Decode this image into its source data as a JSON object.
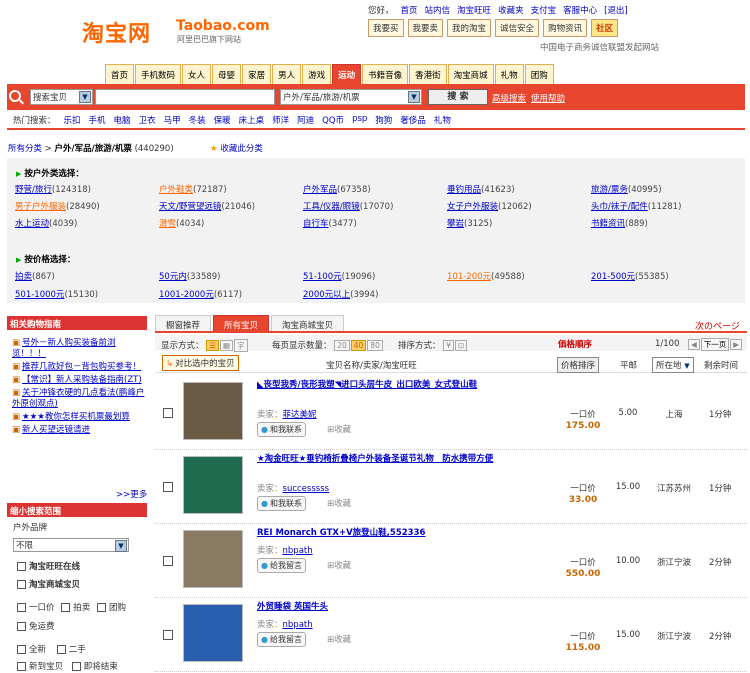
{
  "header": {
    "logo_cn": "淘宝网",
    "logo_en": "Taobao.com",
    "logo_sub": "阿里巴巴旗下网站",
    "greeting": "您好，",
    "top_links": [
      "首页",
      "站内信",
      "淘宝旺旺",
      "收藏夹",
      "支付宝",
      "客服中心",
      "[退出]"
    ],
    "top_buttons": [
      "我要买",
      "我要卖",
      "我的淘宝",
      "诚信安全",
      "购物资讯",
      "社区"
    ],
    "slogan": "中国电子商务诚信联盟发起网站"
  },
  "nav": {
    "tabs": [
      "首页",
      "手机数码",
      "女人",
      "母婴",
      "家居",
      "男人",
      "游戏",
      "运动",
      "书籍音像",
      "香港街",
      "淘宝商城",
      "礼物",
      "团购"
    ],
    "active_index": 7
  },
  "search": {
    "type_select": "搜索宝贝",
    "query": "",
    "category_select": "户外/军品/旅游/机票",
    "button": "搜 索",
    "advanced": "高级搜索",
    "help": "使用帮助"
  },
  "hot": {
    "label": "热门搜索：",
    "items": [
      "乐扣",
      "手机",
      "电脑",
      "卫衣",
      "马甲",
      "冬装",
      "保暖",
      "床上桌",
      "师洋",
      "阿迪",
      "QQ币",
      "psp",
      "狗狗",
      "奢侈品",
      "礼物"
    ]
  },
  "breadcrumb": {
    "root": "所有分类",
    "sep": ">",
    "current": "户外/军品/旅游/机票",
    "count": "(440290)",
    "favorite": "收藏此分类"
  },
  "outdoor_section": {
    "title": "按户外类选择：",
    "items": [
      {
        "name": "野营/旅行",
        "count": "(124318)",
        "style": "n"
      },
      {
        "name": "户外鞋类",
        "count": "(72187)",
        "style": "or"
      },
      {
        "name": "户外军品",
        "count": "(67358)",
        "style": "n"
      },
      {
        "name": "垂钓用品",
        "count": "(41623)",
        "style": "n"
      },
      {
        "name": "旅游/票务",
        "count": "(40995)",
        "style": "n"
      },
      {
        "name": "男子户外服装",
        "count": "(28490)",
        "style": "or"
      },
      {
        "name": "天文/野营望远镜",
        "count": "(21046)",
        "style": "n"
      },
      {
        "name": "工具/仪器/眼镜",
        "count": "(17070)",
        "style": "n"
      },
      {
        "name": "女子户外服装",
        "count": "(12062)",
        "style": "n"
      },
      {
        "name": "头巾/袜子/配件",
        "count": "(11281)",
        "style": "n"
      },
      {
        "name": "水上运动",
        "count": "(4039)",
        "style": "n"
      },
      {
        "name": "滑雪",
        "count": "(4034)",
        "style": "or"
      },
      {
        "name": "自行车",
        "count": "(3477)",
        "style": "n"
      },
      {
        "name": "攀岩",
        "count": "(3125)",
        "style": "n"
      },
      {
        "name": "书籍资讯",
        "count": "(889)",
        "style": "n"
      }
    ]
  },
  "price_section": {
    "title": "按价格选择：",
    "items": [
      {
        "name": "拍卖",
        "count": "(867)",
        "style": "n"
      },
      {
        "name": "50元内",
        "count": "(33589)",
        "style": "n"
      },
      {
        "name": "51-100元",
        "count": "(19096)",
        "style": "n"
      },
      {
        "name": "101-200元",
        "count": "(49588)",
        "style": "or"
      },
      {
        "name": "201-500元",
        "count": "(55385)",
        "style": "n"
      },
      {
        "name": "501-1000元",
        "count": "(15130)",
        "style": "n"
      },
      {
        "name": "1001-2000元",
        "count": "(6117)",
        "style": "n"
      },
      {
        "name": "2000元以上",
        "count": "(3994)",
        "style": "n"
      }
    ]
  },
  "sidebar": {
    "guide_title": "相关购物指南",
    "guide_items": [
      "号外－新人购买装备前浏览！！！",
      "推荐几款好包－背包购买参考！",
      "【常识】新人采购装备指南(ZT)",
      "关于冲锋衣硬的几点看法(鹏峰户外原创观点)",
      "★★★教你怎样买机票最划算",
      "新人买望远镜请进"
    ],
    "more": ">>更多",
    "narrow_title": "缩小搜索范围",
    "brand_label": "户外品牌",
    "brand_value": "不限",
    "filters": [
      "淘宝旺旺在线",
      "淘宝商城宝贝"
    ],
    "buy_types": [
      "一口价",
      "拍卖",
      "团购"
    ],
    "free_ship": "免运费",
    "conditions": [
      "全新",
      "二手"
    ],
    "misc": [
      "新到宝贝",
      "即将结束"
    ]
  },
  "main": {
    "tabs": [
      "橱窗推荐",
      "所有宝贝",
      "淘宝商城宝贝"
    ],
    "active_tab": 1,
    "next_page_hint": "次のページ",
    "display_label": "显示方式：",
    "per_page_label": "每页显示数量：",
    "per_page_options": [
      "20",
      "40",
      "80"
    ],
    "per_page_selected": "40",
    "sort_label": "排序方式：",
    "sort_icons": [
      "¥",
      "⊡"
    ],
    "price_order_hint": "価格順序",
    "page_info": "1/100",
    "next_btn": "下一页",
    "compare": "对比选中的宝贝",
    "col_title": "宝贝名称/卖家/淘宝旺旺",
    "col_price": "价格排序",
    "col_ship": "平邮",
    "col_loc": "所在地",
    "col_time": "剩余时间"
  },
  "products": [
    {
      "title": "◣丧型我秀/丧形我塑◥进口头层牛皮_出口欧美_女式登山鞋",
      "seller": "菲达美妮",
      "contact": "和我联系",
      "collect": "收藏",
      "type": "一口价",
      "price": "175.00",
      "ship": "5.00",
      "loc": "上海",
      "time": "1分钟",
      "img": "#6b5a44"
    },
    {
      "title": "★淘金旺旺★垂钓椅折叠椅户外装备圣诞节礼物　防水携带方便",
      "seller": "successsss",
      "contact": "和我联系",
      "collect": "收藏",
      "type": "一口价",
      "price": "33.00",
      "ship": "15.00",
      "loc": "江苏苏州",
      "time": "1分钟",
      "img": "#1f6b4f"
    },
    {
      "title": "REI Monarch GTX+V旅登山鞋,552336",
      "seller": "nbpath",
      "contact": "给我留言",
      "collect": "收藏",
      "type": "一口价",
      "price": "550.00",
      "ship": "10.00",
      "loc": "浙江宁波",
      "time": "2分钟",
      "img": "#8a7a62"
    },
    {
      "title": "外贸睡袋 英国牛头",
      "seller": "nbpath",
      "contact": "给我留言",
      "collect": "收藏",
      "type": "一口价",
      "price": "115.00",
      "ship": "15.00",
      "loc": "浙江宁波",
      "time": "2分钟",
      "img": "#2a5fb0"
    }
  ]
}
